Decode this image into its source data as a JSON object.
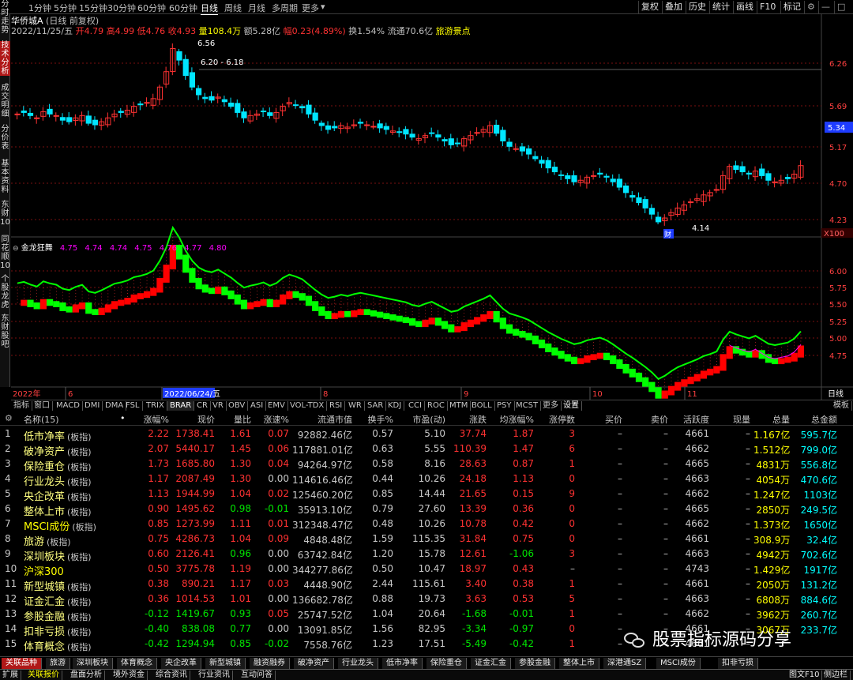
{
  "top_periods": [
    "分时",
    "1分钟",
    "5分钟",
    "15分钟",
    "30分钟",
    "60分钟",
    "日线",
    "周线",
    "月线",
    "多周期",
    "更多"
  ],
  "top_active_period": "日线",
  "top_tools": [
    "复权",
    "叠加",
    "历史",
    "统计",
    "画线",
    "F10",
    "标记"
  ],
  "left_tabs": [
    "分时走势",
    "技术分析",
    "成交明细",
    "分价表",
    "基本资料",
    "东财10",
    "同花顺10",
    "个股龙虎",
    "东财股吧"
  ],
  "left_active": "技术分析",
  "stock": {
    "name": "华侨城A",
    "mode": "(日线 前复权)"
  },
  "info": {
    "date": "2022/11/25/五",
    "open_label": "开",
    "open": "4.79",
    "high_label": "高",
    "high": "4.99",
    "low_label": "低",
    "low": "4.76",
    "close_label": "收",
    "close": "4.93",
    "vol_label": "量",
    "vol": "108.4万",
    "amt_label": "额",
    "amt": "5.28亿",
    "chg_label": "幅",
    "chg": "0.23(4.89%)",
    "turn_label": "换",
    "turn": "1.54%",
    "float_label": "流通",
    "float": "70.6亿",
    "sector": "旅游景点"
  },
  "main_y_ticks": [
    "6.26",
    "5.69",
    "5.17",
    "4.70",
    "4.23"
  ],
  "price_current": "5.34",
  "annotations": {
    "high": "6.56",
    "range": "6.20 - 6.18",
    "low": "4.14",
    "cai": "财",
    "scale": "X100"
  },
  "indicator": {
    "name": "金龙狂舞",
    "values": [
      "4.75",
      "4.74",
      "4.74",
      "4.75",
      "4.76",
      "4.77",
      "4.80"
    ]
  },
  "indicator_y_ticks": [
    "6.00",
    "5.75",
    "5.50",
    "5.25",
    "5.00",
    "4.75"
  ],
  "x_labels": [
    "2022年",
    "6",
    "2022/06/24/五",
    "8",
    "9",
    "10",
    "11"
  ],
  "x_right": "日线",
  "indicator_tabs": [
    "指标",
    "窗口",
    "MACD",
    "DMI",
    "DMA",
    "FSL",
    "TRIX",
    "BRAR",
    "CR",
    "VR",
    "OBV",
    "ASI",
    "EMV",
    "VOL-TDX",
    "RSI",
    "WR",
    "SAR",
    "KDJ",
    "CCI",
    "ROC",
    "MTM",
    "BOLL",
    "PSY",
    "MCST",
    "更多",
    "设置"
  ],
  "tab_model": "模板",
  "table": {
    "headers": [
      "名称(15)",
      "涨幅%",
      "现价",
      "量比",
      "涨速%",
      "流通市值",
      "换手%",
      "市盈(动)",
      "涨跌",
      "均涨幅%",
      "涨停数",
      "买价",
      "卖价",
      "活跃度",
      "现量",
      "总量",
      "总金额"
    ],
    "rows": [
      {
        "no": "1",
        "name": "低市净率",
        "tag": "(板指)",
        "chg": "2.22",
        "price": "1738.41",
        "lb": "1.61",
        "speed": "0.07",
        "mv": "92882.46亿",
        "turn": "0.57",
        "pe": "5.10",
        "diff": "37.74",
        "avg": "1.87",
        "zt": "3",
        "buy": "–",
        "sell": "–",
        "act": "4661",
        "now": "–",
        "vol": "1.167亿",
        "amt": "595.7亿"
      },
      {
        "no": "2",
        "name": "破净资产",
        "tag": "(板指)",
        "chg": "2.07",
        "price": "5440.17",
        "lb": "1.45",
        "speed": "0.06",
        "mv": "117881.01亿",
        "turn": "0.63",
        "pe": "5.55",
        "diff": "110.39",
        "avg": "1.47",
        "zt": "6",
        "buy": "–",
        "sell": "–",
        "act": "4662",
        "now": "–",
        "vol": "1.512亿",
        "amt": "799.0亿"
      },
      {
        "no": "3",
        "name": "保险重仓",
        "tag": "(板指)",
        "chg": "1.73",
        "price": "1685.80",
        "lb": "1.30",
        "speed": "0.04",
        "mv": "94264.97亿",
        "turn": "0.58",
        "pe": "8.16",
        "diff": "28.63",
        "avg": "0.87",
        "zt": "1",
        "buy": "–",
        "sell": "–",
        "act": "4665",
        "now": "–",
        "vol": "4831万",
        "amt": "556.8亿"
      },
      {
        "no": "4",
        "name": "行业龙头",
        "tag": "(板指)",
        "chg": "1.17",
        "price": "2087.49",
        "lb": "1.30",
        "speed": "0.00",
        "mv": "114616.46亿",
        "turn": "0.44",
        "pe": "10.26",
        "diff": "24.18",
        "avg": "1.13",
        "zt": "0",
        "buy": "–",
        "sell": "–",
        "act": "4663",
        "now": "–",
        "vol": "4054万",
        "amt": "470.6亿"
      },
      {
        "no": "5",
        "name": "央企改革",
        "tag": "(板指)",
        "chg": "1.13",
        "price": "1944.99",
        "lb": "1.04",
        "speed": "0.02",
        "mv": "125460.20亿",
        "turn": "0.85",
        "pe": "14.44",
        "diff": "21.65",
        "avg": "0.15",
        "zt": "9",
        "buy": "–",
        "sell": "–",
        "act": "4662",
        "now": "–",
        "vol": "1.247亿",
        "amt": "1103亿"
      },
      {
        "no": "6",
        "name": "整体上市",
        "tag": "(板指)",
        "chg": "0.90",
        "price": "1495.62",
        "lb": "0.98",
        "speed": "-0.01",
        "mv": "35913.10亿",
        "turn": "0.79",
        "pe": "27.60",
        "diff": "13.39",
        "avg": "0.36",
        "zt": "0",
        "buy": "–",
        "sell": "–",
        "act": "4665",
        "now": "–",
        "vol": "2850万",
        "amt": "249.5亿"
      },
      {
        "no": "7",
        "name": "MSCI成份",
        "tag": "(板指)",
        "chg": "0.85",
        "price": "1273.99",
        "lb": "1.11",
        "speed": "0.01",
        "mv": "312348.47亿",
        "turn": "0.48",
        "pe": "10.26",
        "diff": "10.78",
        "avg": "0.42",
        "zt": "0",
        "buy": "–",
        "sell": "–",
        "act": "4662",
        "now": "–",
        "vol": "1.373亿",
        "amt": "1650亿"
      },
      {
        "no": "8",
        "name": "旅游",
        "tag": "(板指)",
        "chg": "0.75",
        "price": "4286.73",
        "lb": "1.04",
        "speed": "0.09",
        "mv": "4848.48亿",
        "turn": "1.59",
        "pe": "115.35",
        "diff": "31.84",
        "avg": "0.75",
        "zt": "0",
        "buy": "–",
        "sell": "–",
        "act": "4661",
        "now": "–",
        "vol": "308.9万",
        "amt": "32.4亿"
      },
      {
        "no": "9",
        "name": "深圳板块",
        "tag": "(板指)",
        "chg": "0.60",
        "price": "2126.41",
        "lb": "0.96",
        "speed": "0.00",
        "mv": "63742.84亿",
        "turn": "1.20",
        "pe": "15.78",
        "diff": "12.61",
        "avg": "-1.06",
        "zt": "3",
        "buy": "–",
        "sell": "–",
        "act": "4663",
        "now": "–",
        "vol": "4942万",
        "amt": "702.6亿"
      },
      {
        "no": "10",
        "name": "沪深300",
        "tag": "",
        "chg": "0.50",
        "price": "3775.78",
        "lb": "1.19",
        "speed": "0.00",
        "mv": "344277.86亿",
        "turn": "0.50",
        "pe": "10.47",
        "diff": "18.97",
        "avg": "0.43",
        "zt": "–",
        "buy": "–",
        "sell": "–",
        "act": "4743",
        "now": "–",
        "vol": "1.429亿",
        "amt": "1917亿"
      },
      {
        "no": "11",
        "name": "新型城镇",
        "tag": "(板指)",
        "chg": "0.38",
        "price": "890.21",
        "lb": "1.17",
        "speed": "0.03",
        "mv": "4448.90亿",
        "turn": "2.44",
        "pe": "115.61",
        "diff": "3.40",
        "avg": "0.38",
        "zt": "1",
        "buy": "–",
        "sell": "–",
        "act": "4661",
        "now": "–",
        "vol": "2050万",
        "amt": "131.2亿"
      },
      {
        "no": "12",
        "name": "证金汇金",
        "tag": "(板指)",
        "chg": "0.36",
        "price": "1014.53",
        "lb": "1.01",
        "speed": "0.00",
        "mv": "136682.78亿",
        "turn": "0.88",
        "pe": "19.73",
        "diff": "3.63",
        "avg": "0.53",
        "zt": "5",
        "buy": "–",
        "sell": "–",
        "act": "4663",
        "now": "–",
        "vol": "6808万",
        "amt": "884.6亿"
      },
      {
        "no": "13",
        "name": "参股金融",
        "tag": "(板指)",
        "chg": "-0.12",
        "price": "1419.67",
        "lb": "0.93",
        "speed": "0.05",
        "mv": "25747.52亿",
        "turn": "1.04",
        "pe": "20.64",
        "diff": "-1.68",
        "avg": "-0.01",
        "zt": "1",
        "buy": "–",
        "sell": "–",
        "act": "4662",
        "now": "–",
        "vol": "3962万",
        "amt": "260.7亿"
      },
      {
        "no": "14",
        "name": "扣非亏损",
        "tag": "(板指)",
        "chg": "-0.40",
        "price": "838.08",
        "lb": "0.77",
        "speed": "0.00",
        "mv": "13091.85亿",
        "turn": "1.56",
        "pe": "82.95",
        "diff": "-3.34",
        "avg": "-0.97",
        "zt": "0",
        "buy": "–",
        "sell": "–",
        "act": "4661",
        "now": "–",
        "vol": "3067万",
        "amt": "233.7亿"
      },
      {
        "no": "15",
        "name": "体育概念",
        "tag": "(板指)",
        "chg": "-0.42",
        "price": "1294.94",
        "lb": "0.85",
        "speed": "-0.02",
        "mv": "7558.76亿",
        "turn": "1.23",
        "pe": "17.51",
        "diff": "-5.49",
        "avg": "-0.42",
        "zt": "1",
        "buy": "–",
        "sell": "–",
        "act": "4661",
        "now": "–",
        "vol": "",
        "amt": ""
      }
    ]
  },
  "bottom_tabs": [
    "关联品种",
    "旅游",
    "深圳板块",
    "体育概念",
    "央企改革",
    "新型城镇",
    "融资融券",
    "破净资产",
    "行业龙头",
    "低市净率",
    "保险重仓",
    "证金汇金",
    "参股金融",
    "整体上市",
    "深港通SZ",
    "MSCI成份",
    "扣非亏损"
  ],
  "status_tabs": [
    "扩展",
    "关联报价",
    "盘面分析",
    "境外资金",
    "综合资讯",
    "行业资讯",
    "互动问答"
  ],
  "status_right": [
    "图文F10",
    "侧边栏"
  ],
  "watermark": "股票指标源码分享",
  "colors": {
    "up": "#ff3232",
    "down": "#00e6ff",
    "ind_up": "#ff0000",
    "ind_down": "#00ff00",
    "active_tab": "#b01818"
  }
}
